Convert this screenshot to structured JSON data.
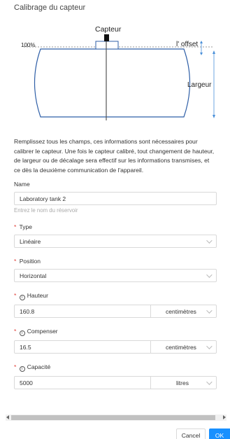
{
  "dialog": {
    "title": "Calibrage du capteur",
    "diagram": {
      "sensor_label": "Capteur",
      "percent_label": "100%",
      "offset_label": "l' offset",
      "width_label": "Largeur"
    },
    "description": "Remplissez tous les champs, ces informations sont nécessaires pour calibrer le capteur. Une fois le capteur calibré, tout changement de hauteur, de largeur ou de décalage sera effectif sur les informations transmises, et ce dès la deuxième communication de l'appareil."
  },
  "form": {
    "name": {
      "label": "Name",
      "value": "Laboratory tank 2",
      "hint": "Entrez le nom du réservoir"
    },
    "type": {
      "label": "Type",
      "value": "Linéaire"
    },
    "position": {
      "label": "Position",
      "value": "Horizontal"
    },
    "height": {
      "label": "Hauteur",
      "value": "160.8",
      "unit": "centimètres"
    },
    "offset": {
      "label": "Compenser",
      "value": "16.5",
      "unit": "centimètres"
    },
    "capacity": {
      "label": "Capacité",
      "value": "5000",
      "unit": "litres"
    }
  },
  "footer": {
    "cancel_label": "Cancel",
    "ok_label": "OK"
  },
  "colors": {
    "primary": "#1890ff",
    "tank_stroke": "#2f5fa7",
    "required": "#e0413a"
  }
}
